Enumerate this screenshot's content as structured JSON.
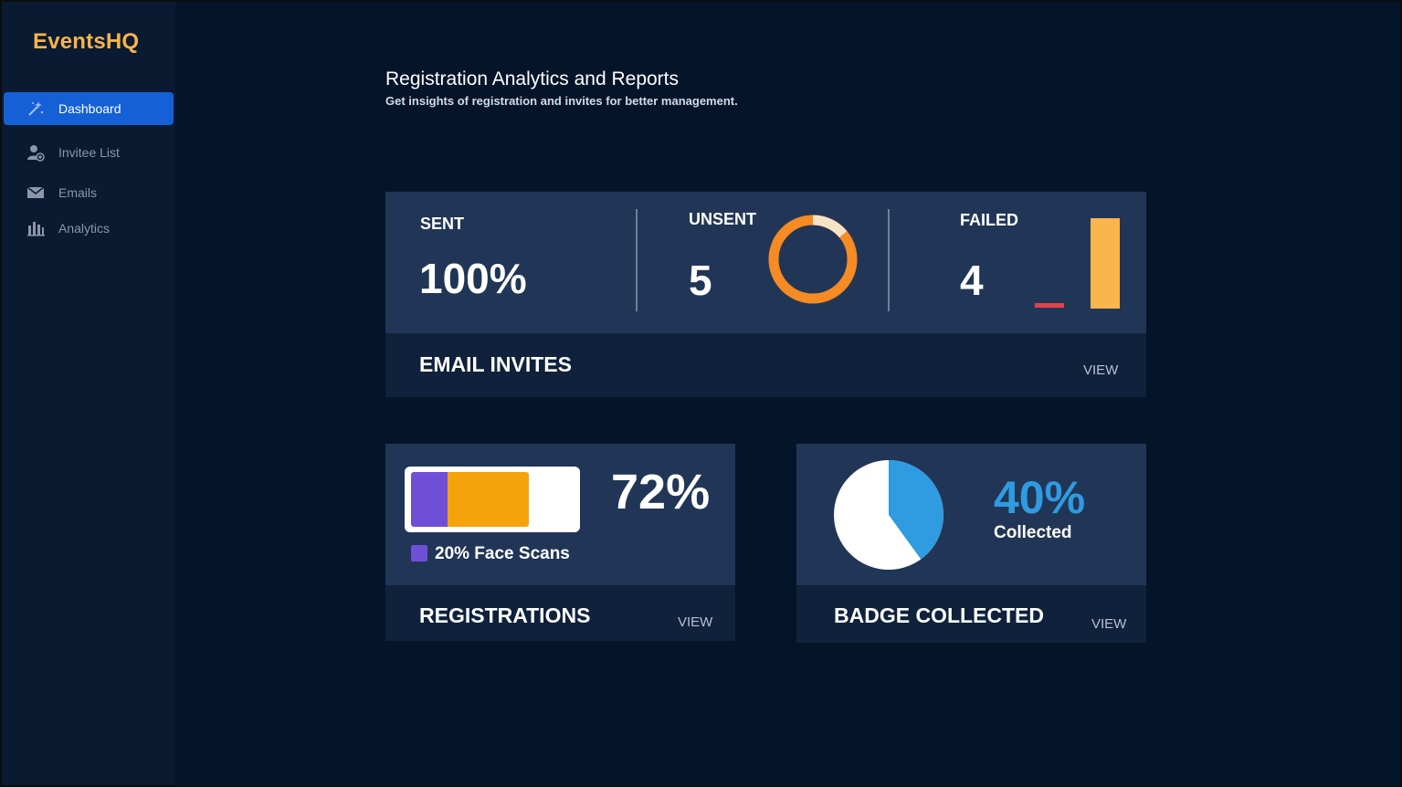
{
  "app": {
    "name": "EventsHQ"
  },
  "sidebar": {
    "items": [
      {
        "label": "Dashboard",
        "icon": "magic-wand-icon",
        "active": true
      },
      {
        "label": "Invitee List",
        "icon": "add-user-icon",
        "active": false
      },
      {
        "label": "Emails",
        "icon": "envelope-icon",
        "active": false
      },
      {
        "label": "Analytics",
        "icon": "bar-chart-icon",
        "active": false
      }
    ]
  },
  "header": {
    "title": "Registration Analytics and Reports",
    "subtitle": "Get insights of registration and invites for better management."
  },
  "email_invites": {
    "title": "EMAIL INVITES",
    "view_label": "VIEW",
    "sent": {
      "label": "SENT",
      "value": "100%"
    },
    "unsent": {
      "label": "UNSENT",
      "value": "5",
      "donut_fraction": 0.14
    },
    "failed": {
      "label": "FAILED",
      "value": "4"
    }
  },
  "registrations": {
    "title": "REGISTRATIONS",
    "view_label": "VIEW",
    "value": "72%",
    "legend": "20% Face Scans",
    "face_scan_fraction": 0.2,
    "registration_fraction": 0.72
  },
  "badge_collected": {
    "title": "BADGE COLLECTED",
    "view_label": "VIEW",
    "value": "40%",
    "caption": "Collected",
    "collected_fraction": 0.4
  },
  "colors": {
    "accent": "#1560d6",
    "brand": "#f7b44a",
    "orange": "#f5a30b",
    "donut": "#f68a23",
    "purple": "#6f4fd6",
    "blue": "#2f9be0",
    "red": "#e0424a"
  }
}
